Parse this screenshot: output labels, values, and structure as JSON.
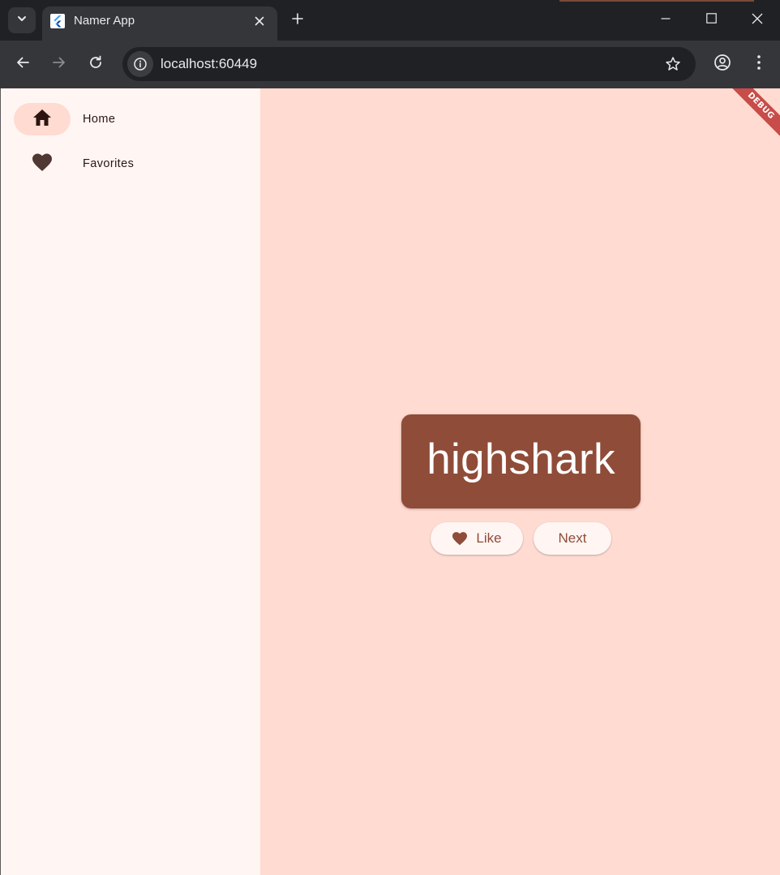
{
  "browser": {
    "tab": {
      "title": "Namer App"
    },
    "address_bar": {
      "url": "localhost:60449"
    },
    "colors": {
      "frame": "#202124",
      "toolbar": "#35363a",
      "text": "#e8eaed"
    }
  },
  "app": {
    "navigation": {
      "items": [
        {
          "label": "Home",
          "icon": "home-icon",
          "selected": true
        },
        {
          "label": "Favorites",
          "icon": "heart-icon",
          "selected": false
        }
      ]
    },
    "main": {
      "current_word": "highshark",
      "like_label": "Like",
      "next_label": "Next"
    },
    "debug_banner": "DEBUG",
    "colors": {
      "primary": "#8f4c38",
      "background": "#ffdbd1",
      "rail": "#fff6f4",
      "on_surface": "#2c1511"
    }
  }
}
